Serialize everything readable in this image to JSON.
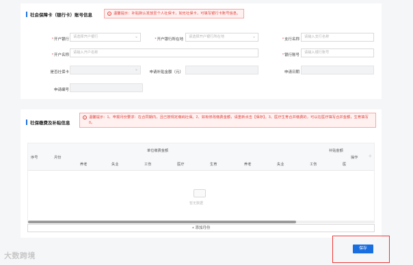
{
  "section1": {
    "title": "社会保障卡（银行卡）账号信息",
    "tip": "温馨提示：补贴默认发放至个人社保卡，如无社保卡，可填写银行卡账号信息。",
    "fields": {
      "bank_label": "开户银行",
      "bank_placeholder": "请选择开户银行",
      "bank_region_label": "开户银行所在地",
      "bank_region_placeholder": "请选择开户银行所在地",
      "branch_label": "支行名称",
      "branch_placeholder": "请输入支行名称",
      "account_name_label": "开户名称",
      "account_name_placeholder": "请输入开户名称",
      "account_no_label": "银行账号",
      "account_no_placeholder": "请输入银行账号",
      "is_social_card_label": "是否社保卡",
      "apply_amount_label": "申请补贴金额（元）",
      "apply_date_label": "申请日期",
      "apply_no_label": "申请编号"
    }
  },
  "section2": {
    "title": "社保缴费及补贴信息",
    "tip": "温馨提示：1、申报月份要求：在合同期内，且已按规定缴纳社保。2、如有修改缴费金额，请重新点击【保存】。3、医疗生育合并缴费的，可以在医疗填写合并金额，生育填写0。",
    "table": {
      "col_seq": "序号",
      "col_month": "月份",
      "group_unit": "单位缴费金额",
      "group_subsidy": "补贴金额",
      "col_action": "操作",
      "unit_cols": [
        "养老",
        "失业",
        "工伤",
        "医疗",
        "生育"
      ],
      "subsidy_cols": [
        "养老",
        "失业",
        "工伤",
        "医"
      ],
      "empty_text": "暂无数据"
    },
    "add_button": "+ 添加月份"
  },
  "actions": {
    "save": "保存"
  },
  "watermark": "大数跨境",
  "colors": {
    "primary": "#1a6fe0",
    "danger": "#e0423c",
    "tip_bg": "#fff1f0"
  }
}
